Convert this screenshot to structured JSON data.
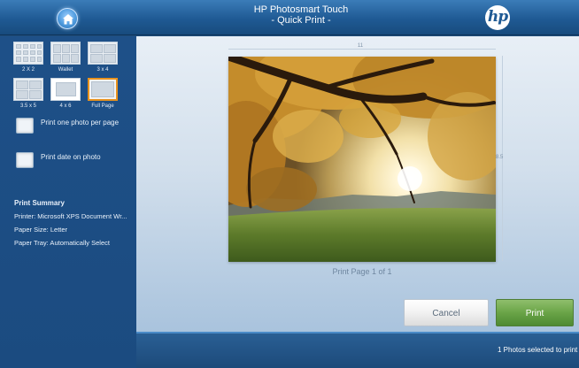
{
  "header": {
    "title_line1": "HP Photosmart Touch",
    "title_line2": "- Quick Print -",
    "home_icon": "home-icon",
    "logo_text": "hp"
  },
  "layouts": [
    {
      "label": "2 X 2",
      "selected": false
    },
    {
      "label": "Wallet",
      "selected": false
    },
    {
      "label": "3 x 4",
      "selected": false
    },
    {
      "label": "3.5 x 5",
      "selected": false
    },
    {
      "label": "4 x 6",
      "selected": false
    },
    {
      "label": "Full Page",
      "selected": true
    }
  ],
  "options": {
    "one_per_page": "Print one photo per page",
    "print_date": "Print date on photo"
  },
  "summary": {
    "title": "Print Summary",
    "printer": "Printer: Microsoft XPS Document Wr...",
    "paper_size": "Paper Size: Letter",
    "paper_tray": "Paper Tray: Automatically Select"
  },
  "preview": {
    "width_label": "11",
    "height_label": "8.5",
    "page_label": "Print Page 1 of 1"
  },
  "buttons": {
    "cancel": "Cancel",
    "print": "Print"
  },
  "status": {
    "selected_text": "1 Photos selected to print"
  },
  "colors": {
    "accent_orange": "#e8921e",
    "print_green": "#6aa447",
    "header_blue": "#1f5a94"
  }
}
